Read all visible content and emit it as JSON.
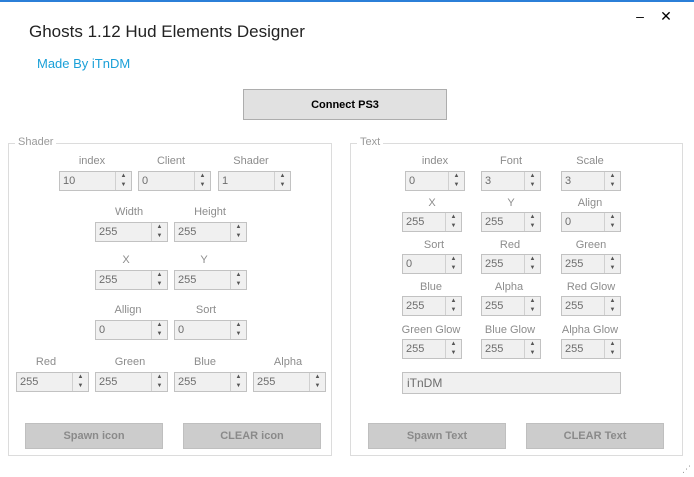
{
  "window": {
    "title": "Ghosts 1.12 Hud Elements Designer",
    "subtitle": "Made By iTnDM",
    "minimize_label": "–",
    "close_label": "✕"
  },
  "connect_button": "Connect PS3",
  "shader": {
    "legend": "Shader",
    "fields": [
      {
        "key": "index",
        "label": "index",
        "value": "10"
      },
      {
        "key": "client",
        "label": "Client",
        "value": "0"
      },
      {
        "key": "shader",
        "label": "Shader",
        "value": "1"
      },
      {
        "key": "width",
        "label": "Width",
        "value": "255"
      },
      {
        "key": "height",
        "label": "Height",
        "value": "255"
      },
      {
        "key": "x",
        "label": "X",
        "value": "255"
      },
      {
        "key": "y",
        "label": "Y",
        "value": "255"
      },
      {
        "key": "allign",
        "label": "Allign",
        "value": "0"
      },
      {
        "key": "sort",
        "label": "Sort",
        "value": "0"
      },
      {
        "key": "red",
        "label": "Red",
        "value": "255"
      },
      {
        "key": "green",
        "label": "Green",
        "value": "255"
      },
      {
        "key": "blue",
        "label": "Blue",
        "value": "255"
      },
      {
        "key": "alpha",
        "label": "Alpha",
        "value": "255"
      }
    ],
    "spawn_button": "Spawn icon",
    "clear_button": "CLEAR icon"
  },
  "text": {
    "legend": "Text",
    "fields": [
      {
        "key": "index",
        "label": "index",
        "value": "0"
      },
      {
        "key": "font",
        "label": "Font",
        "value": "3"
      },
      {
        "key": "scale",
        "label": "Scale",
        "value": "3"
      },
      {
        "key": "x",
        "label": "X",
        "value": "255"
      },
      {
        "key": "y",
        "label": "Y",
        "value": "255"
      },
      {
        "key": "align",
        "label": "Align",
        "value": "0"
      },
      {
        "key": "sort",
        "label": "Sort",
        "value": "0"
      },
      {
        "key": "red",
        "label": "Red",
        "value": "255"
      },
      {
        "key": "green",
        "label": "Green",
        "value": "255"
      },
      {
        "key": "blue",
        "label": "Blue",
        "value": "255"
      },
      {
        "key": "alpha",
        "label": "Alpha",
        "value": "255"
      },
      {
        "key": "red_glow",
        "label": "Red Glow",
        "value": "255"
      },
      {
        "key": "green_glow",
        "label": "Green Glow",
        "value": "255"
      },
      {
        "key": "blue_glow",
        "label": "Blue Glow",
        "value": "255"
      },
      {
        "key": "alpha_glow",
        "label": "Alpha Glow",
        "value": "255"
      }
    ],
    "text_value": "iTnDM",
    "spawn_button": "Spawn Text",
    "clear_button": "CLEAR Text"
  },
  "colors": {
    "accent": "#1aa0d8",
    "title_bar_border": "#2b7fd8"
  },
  "icons": {
    "minimize": "minimize-icon",
    "close": "close-icon",
    "spin_up": "chevron-up-icon",
    "spin_down": "chevron-down-icon",
    "grip": "resize-grip-icon"
  }
}
